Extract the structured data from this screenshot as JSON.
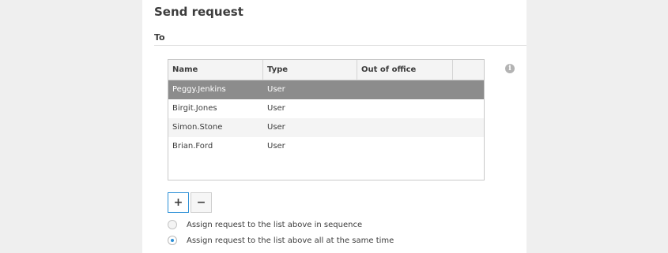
{
  "dialog": {
    "title": "Send request"
  },
  "section": {
    "label": "To"
  },
  "table": {
    "columns": [
      "Name",
      "Type",
      "Out of office",
      ""
    ],
    "rows": [
      {
        "name": "Peggy.Jenkins",
        "type": "User",
        "out_of_office": "",
        "selected": true
      },
      {
        "name": "Birgit.Jones",
        "type": "User",
        "out_of_office": ""
      },
      {
        "name": "Simon.Stone",
        "type": "User",
        "out_of_office": ""
      },
      {
        "name": "Brian.Ford",
        "type": "User",
        "out_of_office": ""
      }
    ]
  },
  "toolbar": {
    "add_label": "+",
    "remove_label": "−"
  },
  "info_icon": {
    "name": "info-icon",
    "glyph": "i"
  },
  "options": [
    {
      "label": "Assign request to the list above in sequence",
      "checked": false
    },
    {
      "label": "Assign request to the list above all at the same time",
      "checked": true
    }
  ],
  "colors": {
    "accent": "#2b8fd6",
    "selected_row": "#8c8c8c"
  }
}
